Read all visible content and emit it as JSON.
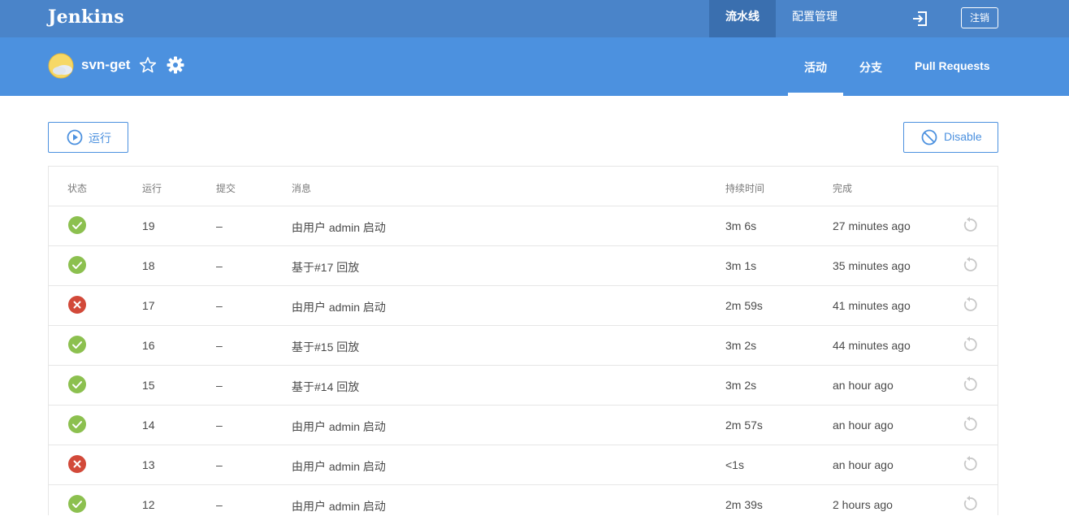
{
  "header": {
    "logo": "Jenkins",
    "nav": [
      {
        "label": "流水线",
        "active": true
      },
      {
        "label": "配置管理",
        "active": false
      }
    ],
    "logout_label": "注销",
    "login_icon": "login-arrow-icon"
  },
  "pipeline": {
    "name": "svn-get",
    "weather_icon": "weather-partly-sunny-icon",
    "tabs": [
      {
        "label": "活动",
        "active": true
      },
      {
        "label": "分支",
        "active": false
      },
      {
        "label": "Pull Requests",
        "active": false
      }
    ]
  },
  "actions": {
    "run_label": "运行",
    "disable_label": "Disable"
  },
  "table": {
    "columns": [
      "状态",
      "运行",
      "提交",
      "消息",
      "持续时间",
      "完成"
    ],
    "rows": [
      {
        "status": "success",
        "run": "19",
        "commit": "–",
        "message": "由用户 admin 启动",
        "duration": "3m 6s",
        "completed": "27 minutes ago"
      },
      {
        "status": "success",
        "run": "18",
        "commit": "–",
        "message": "基于#17 回放",
        "duration": "3m 1s",
        "completed": "35 minutes ago"
      },
      {
        "status": "failure",
        "run": "17",
        "commit": "–",
        "message": "由用户 admin 启动",
        "duration": "2m 59s",
        "completed": "41 minutes ago"
      },
      {
        "status": "success",
        "run": "16",
        "commit": "–",
        "message": "基于#15 回放",
        "duration": "3m 2s",
        "completed": "44 minutes ago"
      },
      {
        "status": "success",
        "run": "15",
        "commit": "–",
        "message": "基于#14 回放",
        "duration": "3m 2s",
        "completed": "an hour ago"
      },
      {
        "status": "success",
        "run": "14",
        "commit": "–",
        "message": "由用户 admin 启动",
        "duration": "2m 57s",
        "completed": "an hour ago"
      },
      {
        "status": "failure",
        "run": "13",
        "commit": "–",
        "message": "由用户 admin 启动",
        "duration": "<1s",
        "completed": "an hour ago"
      },
      {
        "status": "success",
        "run": "12",
        "commit": "–",
        "message": "由用户 admin 启动",
        "duration": "2m 39s",
        "completed": "2 hours ago"
      }
    ]
  },
  "colors": {
    "header_bg": "#4a84c9",
    "subheader_bg": "#4c91df",
    "success": "#8cc04f",
    "failure": "#d24939",
    "accent": "#4c91df"
  }
}
